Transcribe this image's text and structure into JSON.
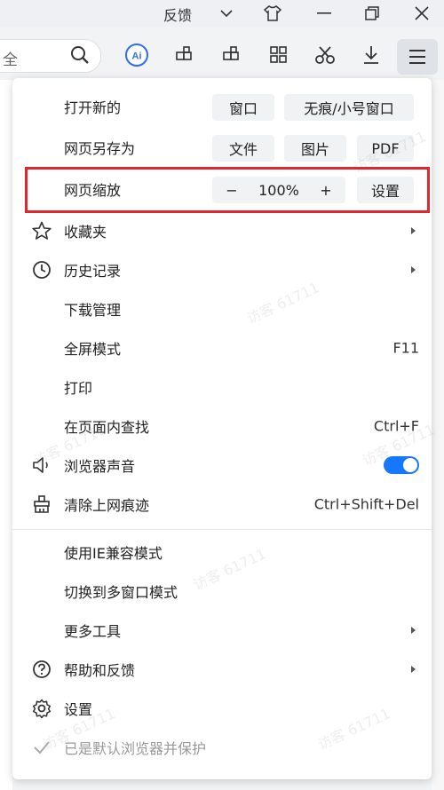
{
  "titlebar": {
    "feedback_label": "反馈"
  },
  "toolbar": {
    "address_text": "全",
    "ai_label": "Ai"
  },
  "menu": {
    "open_new": {
      "label": "打开新的",
      "window": "窗口",
      "incognito": "无痕/小号窗口"
    },
    "save_as": {
      "label": "网页另存为",
      "file": "文件",
      "image": "图片",
      "pdf": "PDF"
    },
    "zoom": {
      "label": "网页缩放",
      "minus": "−",
      "value": "100%",
      "plus": "+",
      "settings": "设置"
    },
    "items": [
      {
        "label": "收藏夹",
        "icon": "star-icon",
        "submenu": true
      },
      {
        "label": "历史记录",
        "icon": "clock-icon",
        "submenu": true
      },
      {
        "label": "下载管理"
      },
      {
        "label": "全屏模式",
        "shortcut": "F11"
      },
      {
        "label": "打印"
      },
      {
        "label": "在页面内查找",
        "shortcut": "Ctrl+F"
      },
      {
        "label": "浏览器声音",
        "icon": "speaker-icon",
        "toggle": true
      },
      {
        "label": "清除上网痕迹",
        "icon": "broom-icon",
        "shortcut": "Ctrl+Shift+Del"
      }
    ],
    "items2": [
      {
        "label": "使用IE兼容模式"
      },
      {
        "label": "切换到多窗口模式"
      },
      {
        "label": "更多工具",
        "submenu": true
      },
      {
        "label": "帮助和反馈",
        "icon": "help-icon",
        "submenu": true
      },
      {
        "label": "设置",
        "icon": "gear-icon"
      },
      {
        "label": "已是默认浏览器并保护",
        "icon": "check-icon",
        "disabled": true
      }
    ]
  },
  "watermark": "访客 61711",
  "colors": {
    "accent": "#1677ff",
    "highlight": "#e0262f"
  }
}
